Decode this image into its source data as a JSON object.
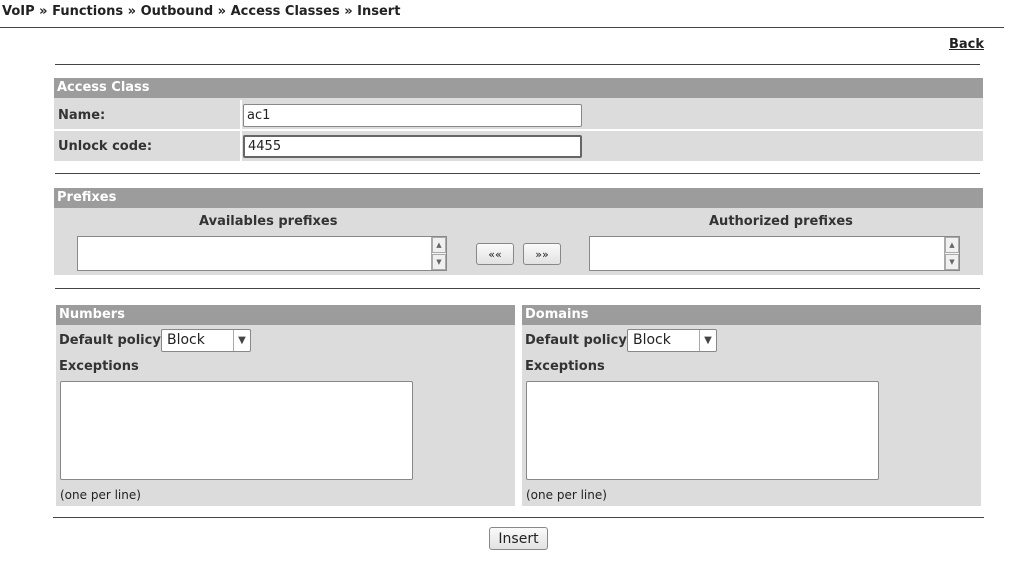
{
  "breadcrumb": "VoIP » Functions » Outbound » Access Classes » Insert",
  "back_label": "Back",
  "access_class": {
    "header": "Access Class",
    "name_label": "Name:",
    "name_value": "ac1",
    "unlock_label": "Unlock code:",
    "unlock_value": "4455"
  },
  "prefixes": {
    "header": "Prefixes",
    "available_label": "Availables prefixes",
    "authorized_label": "Authorized prefixes",
    "move_left_label": "«« ",
    "move_right_label": "»»"
  },
  "numbers": {
    "header": "Numbers",
    "policy_label": "Default policy:",
    "policy_value": "Block",
    "exceptions_label": "Exceptions",
    "hint": "(one per line)"
  },
  "domains": {
    "header": "Domains",
    "policy_label": "Default policy:",
    "policy_value": "Block",
    "exceptions_label": "Exceptions",
    "hint": "(one per line)"
  },
  "insert_label": "Insert"
}
